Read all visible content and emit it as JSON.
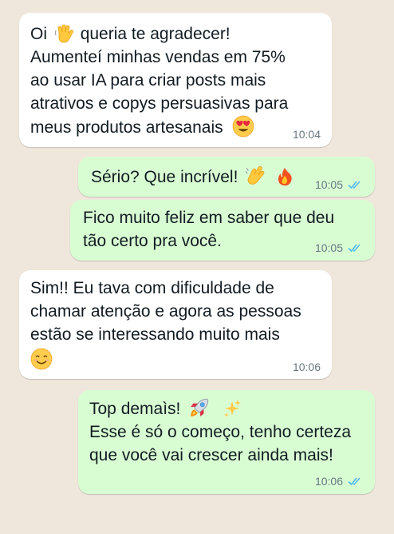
{
  "conversation": {
    "messages": [
      {
        "direction": "incoming",
        "lines": [
          "Oi",
          "queria te agradecer!",
          "Aumenteí minhas vendas em 75%",
          "ao usar IA para criar posts mais",
          "atrativos e copys persuasivas para",
          "meus produtos artesanais"
        ],
        "time": "10:04",
        "emojis": [
          "waving-hand",
          "heart-eyes"
        ]
      },
      {
        "direction": "outgoing",
        "lines": [
          "Sério? Que incrível!"
        ],
        "time": "10:05",
        "status": "read",
        "emojis": [
          "clapping-hands",
          "fire"
        ]
      },
      {
        "direction": "outgoing",
        "lines": [
          "Fico muito feliz em saber que deu",
          "tão certo pra você."
        ],
        "time": "10:05",
        "status": "read"
      },
      {
        "direction": "incoming",
        "lines": [
          "Sim!! Eu tava com dificuldade de",
          "chamar atenção e agora as pessoas",
          "estão se interessando muito mais"
        ],
        "time": "10:06",
        "emojis": [
          "smiling-face"
        ]
      },
      {
        "direction": "outgoing",
        "lines": [
          "Top demaìs!",
          "Esse é só o começo, tenho certeza",
          "que você vai crescer ainda mais!"
        ],
        "time": "10:06",
        "status": "read",
        "emojis": [
          "rocket",
          "sparkles"
        ]
      }
    ]
  },
  "colors": {
    "background": "#efe7dc",
    "incoming_bubble": "#ffffff",
    "outgoing_bubble": "#d9fdd3",
    "read_ticks": "#53bdeb",
    "timestamp": "#667781"
  }
}
